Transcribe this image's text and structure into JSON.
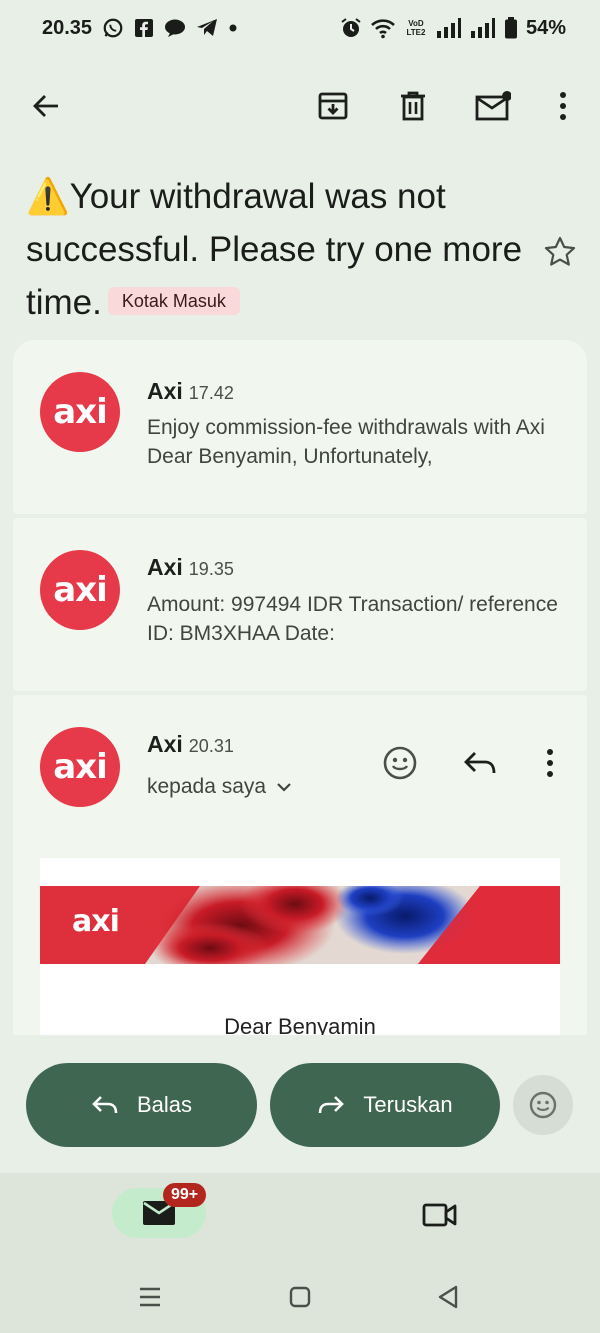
{
  "status_bar": {
    "time": "20.35",
    "battery": "54%",
    "network_badge": "VoD LTE2",
    "icons": [
      "whatsapp-icon",
      "facebook-icon",
      "chat-icon",
      "telegram-icon",
      "dot-icon",
      "alarm-icon",
      "wifi-icon",
      "signal-icon",
      "signal-icon",
      "battery-icon"
    ]
  },
  "toolbar": {
    "icons": [
      "back-arrow-icon",
      "archive-icon",
      "delete-icon",
      "mark-unread-icon",
      "more-vert-icon"
    ]
  },
  "subject": {
    "text": "⚠️Your withdrawal was not successful. Please try one more time.",
    "label": "Kotak Masuk",
    "star_icon": "star-outline-icon"
  },
  "messages": [
    {
      "avatar_text": "axi",
      "sender": "Axi",
      "time": "17.42",
      "snippet": "Enjoy commission-fee withdrawals with Axi Dear Benyamin, Unfortunately,"
    },
    {
      "avatar_text": "axi",
      "sender": "Axi",
      "time": "19.35",
      "snippet": "Amount: 997494 IDR Transaction/ reference ID: BM3XHAA Date:"
    },
    {
      "avatar_text": "axi",
      "sender": "Axi",
      "time": "20.31",
      "recipient": "kepada saya",
      "body": {
        "banner_logo": "axi",
        "greeting": "Dear Benyamin"
      }
    }
  ],
  "actions": {
    "reply_label": "Balas",
    "forward_label": "Teruskan"
  },
  "bottom_nav": {
    "mail_badge": "99+"
  },
  "colors": {
    "background": "#e8efe6",
    "card": "#f1f7ef",
    "brand_red": "#e6394a",
    "action_green": "#3f6651",
    "label_chip": "#f9d9d9",
    "badge_red": "#b3261e"
  }
}
